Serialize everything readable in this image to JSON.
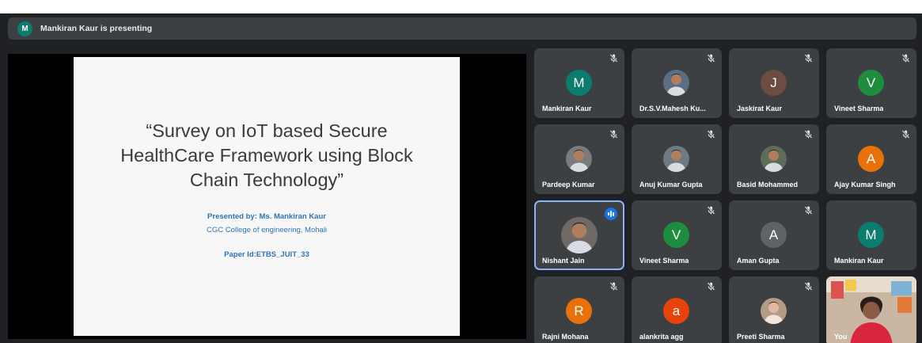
{
  "presenter_bar": {
    "avatar_letter": "M",
    "text": "Mankiran Kaur is presenting"
  },
  "slide": {
    "title_lines": [
      "“Survey on IoT based Secure",
      "HealthCare Framework using Block",
      "Chain Technology”"
    ],
    "presented_by": "Presented by: Ms. Mankiran Kaur",
    "college": "CGC College of engineering, Mohali",
    "paper_id": "Paper Id:ETBS_JUIT_33"
  },
  "participants": [
    {
      "name": "Mankiran Kaur",
      "letter": "M",
      "color": "#0b7d6e",
      "muted": true
    },
    {
      "name": "Dr.S.V.Mahesh Ku...",
      "letter": "",
      "color": "#5a6f86",
      "muted": true,
      "photo": "man-photo"
    },
    {
      "name": "Jaskirat Kaur",
      "letter": "J",
      "color": "#6d4c41",
      "muted": true
    },
    {
      "name": "Vineet Sharma",
      "letter": "V",
      "color": "#1e8e3e",
      "muted": true
    },
    {
      "name": "Pardeep Kumar",
      "letter": "",
      "color": "#7b7b7b",
      "muted": true,
      "photo": "man-photo"
    },
    {
      "name": "Anuj Kumar Gupta",
      "letter": "",
      "color": "#6b7a83",
      "muted": true,
      "photo": "man-photo"
    },
    {
      "name": "Basid Mohammed",
      "letter": "",
      "color": "#5d6d5a",
      "muted": true,
      "photo": "man-photo"
    },
    {
      "name": "Ajay Kumar Singh",
      "letter": "A",
      "color": "#e8710a",
      "muted": true
    },
    {
      "name": "Nishant Jain",
      "letter": "",
      "color": "#6f6a66",
      "muted": false,
      "speaking": true,
      "photo": "man-photo"
    },
    {
      "name": "Vineet Sharma",
      "letter": "V",
      "color": "#1e8e3e",
      "muted": true
    },
    {
      "name": "Aman Gupta",
      "letter": "A",
      "color": "#5f6368",
      "muted": true
    },
    {
      "name": "Mankiran Kaur",
      "letter": "M",
      "color": "#0b7d6e",
      "muted": false
    },
    {
      "name": "Rajni Mohana",
      "letter": "R",
      "color": "#e8710a",
      "muted": true
    },
    {
      "name": "alankrita agg",
      "letter": "a",
      "color": "#e8430a",
      "muted": true
    },
    {
      "name": "Preeti Sharma",
      "letter": "",
      "color": "#b39b86",
      "muted": true,
      "photo": "woman-photo"
    },
    {
      "name": "You",
      "letter": "",
      "color": "#8b5a4e",
      "muted": false,
      "self": true,
      "photo": "self-video"
    }
  ]
}
